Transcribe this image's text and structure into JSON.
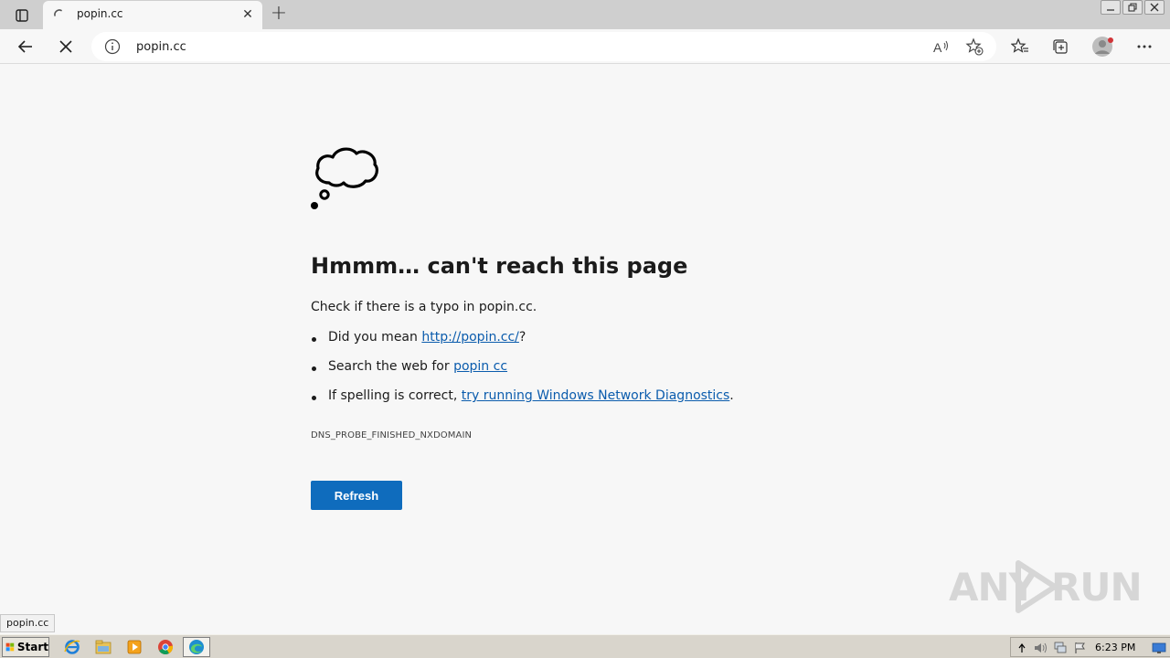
{
  "browser": {
    "tab": {
      "title": "popin.cc",
      "close_glyph": "✕"
    },
    "new_tab_glyph": "+",
    "address": {
      "url": "popin.cc"
    },
    "read_aloud_label": "A",
    "window_controls": [
      "minimize",
      "restore",
      "close"
    ]
  },
  "error_page": {
    "title": "Hmmm… can't reach this page",
    "check_text": "Check if there is a typo in popin.cc.",
    "suggestions": [
      {
        "prefix": "Did you mean ",
        "link": "http://popin.cc/",
        "suffix": "?"
      },
      {
        "prefix": "Search the web for ",
        "link": "popin cc",
        "suffix": ""
      },
      {
        "prefix": "If spelling is correct, ",
        "link": "try running Windows Network Diagnostics",
        "suffix": "."
      }
    ],
    "error_code": "DNS_PROBE_FINISHED_NXDOMAIN",
    "refresh_label": "Refresh"
  },
  "status_bubble": "popin.cc",
  "watermark": {
    "left": "ANY",
    "right": "RUN"
  },
  "taskbar": {
    "start_label": "Start",
    "apps": [
      "ie-icon",
      "explorer-icon",
      "media-player-icon",
      "chrome-icon",
      "edge-icon"
    ],
    "clock": "6:23 PM"
  },
  "colors": {
    "accent": "#0f6cbd",
    "link": "#0b5cad",
    "page_bg": "#f7f7f7",
    "tabstrip_bg": "#cfcfcf",
    "taskbar_bg": "#d9d5cc"
  }
}
